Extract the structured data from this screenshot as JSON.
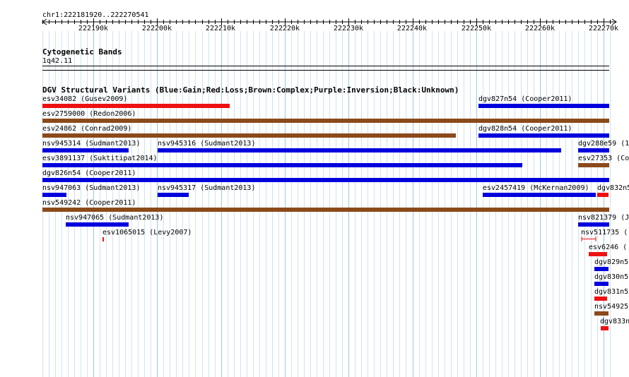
{
  "ruler": {
    "locus": "chr1:222181920..222270541",
    "ticks": [
      "222190k",
      "222200k",
      "222210k",
      "222220k",
      "222230k",
      "222240k",
      "222250k",
      "222260k",
      "222270k"
    ]
  },
  "cytobands": {
    "title": "Cytogenetic Bands",
    "band": "1q42.11"
  },
  "dgv": {
    "title": "DGV Structural Variants (Blue:Gain;Red:Loss;Brown:Complex;Purple:Inversion;Black:Unknown)",
    "colors": {
      "gain": "#0000dd",
      "loss": "#ee1111",
      "complex": "#8b4a1a"
    },
    "features": [
      {
        "label": "esv34082 (Gusev2009)",
        "type": "loss"
      },
      {
        "label": "dgv827n54 (Cooper2011)",
        "type": "gain"
      },
      {
        "label": "esv2759000 (Redon2006)",
        "type": "complex"
      },
      {
        "label": "esv24862 (Conrad2009)",
        "type": "complex"
      },
      {
        "label": "dgv828n54 (Cooper2011)",
        "type": "gain"
      },
      {
        "label": "nsv945314 (Sudmant2013)",
        "type": "gain"
      },
      {
        "label": "nsv945316 (Sudmant2013)",
        "type": "gain"
      },
      {
        "label": "dgv288e59 (1",
        "type": "gain"
      },
      {
        "label": "esv3891137 (Suktitipat2014)",
        "type": "gain"
      },
      {
        "label": "esv27353 (Co",
        "type": "complex"
      },
      {
        "label": "dgv826n54 (Cooper2011)",
        "type": "gain"
      },
      {
        "label": "nsv947063 (Sudmant2013)",
        "type": "gain"
      },
      {
        "label": "nsv945317 (Sudmant2013)",
        "type": "gain"
      },
      {
        "label": "esv2457419 (McKernan2009)",
        "type": "gain"
      },
      {
        "label": "dgv832n5",
        "type": "loss"
      },
      {
        "label": "nsv549242 (Cooper2011)",
        "type": "complex"
      },
      {
        "label": "nsv947065 (Sudmant2013)",
        "type": "gain"
      },
      {
        "label": "nsv821379 (J",
        "type": "gain"
      },
      {
        "label": "esv1065015 (Levy2007)",
        "type": "loss"
      },
      {
        "label": "nsv511735 (",
        "type": "loss"
      },
      {
        "label": "esv6246 (",
        "type": "loss"
      },
      {
        "label": "dgv829n5",
        "type": "gain"
      },
      {
        "label": "dgv830n5",
        "type": "gain"
      },
      {
        "label": "dgv831n5",
        "type": "loss"
      },
      {
        "label": "nsv54925",
        "type": "complex"
      },
      {
        "label": "dgv833n",
        "type": "loss"
      }
    ]
  }
}
